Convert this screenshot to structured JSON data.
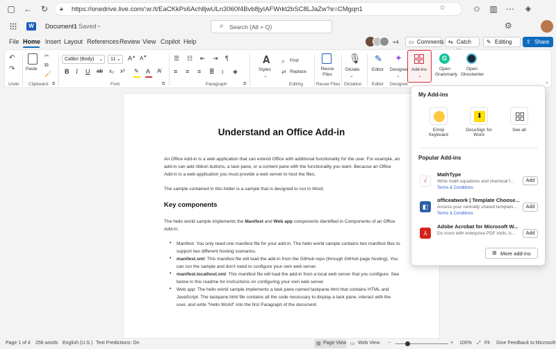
{
  "browser": {
    "url": "https://onedrive.live.com/:w:/t/EaCKkPs6AchlljwULn3060f4Bvb8jyIAFWrkt2bSC8LJaZw?e=CMgqn1"
  },
  "app": {
    "doc_title": "Document1",
    "doc_status": "Saved",
    "search_placeholder": "Search (Alt + Q)",
    "plus_count": "+4"
  },
  "menu": {
    "items": [
      "File",
      "Home",
      "Insert",
      "Layout",
      "References",
      "Review",
      "View",
      "Copilot",
      "Help"
    ],
    "comments": "Comments",
    "catch_up": "Catch Up",
    "editing": "Editing",
    "share": "Share"
  },
  "ribbon": {
    "undo": "Undo",
    "paste": "Paste",
    "clipboard": "Clipboard",
    "font_name": "Calibri (Body)",
    "font_size": "11",
    "font": "Font",
    "paragraph": "Paragraph",
    "styles": "Styles",
    "find": "Find",
    "replace": "Replace",
    "editing": "Editing",
    "reuse_files": "Reuse Files",
    "dictate": "Dictate",
    "dictation": "Dictation",
    "editor": "Editor",
    "designer": "Designer",
    "add_ins": "Add-ins",
    "open_grammarly": "Open Grammarly",
    "open_ghostwriter": "Open Ghostwriter"
  },
  "document": {
    "title": "Understand an Office Add-in",
    "p1": "An Office Add-in is a web application that can extend Office with additional functionality for the user. For example, an add-in can add ribbon buttons, a task pane, or a content pane with the functionality you want. Because an Office Add-in is a web application you must provide a web server to host the files.",
    "p2": "The sample contained in this folder is a sample that is designed to run in Word.",
    "h2": "Key components",
    "p3a": "The hello world sample implements the ",
    "p3b": "Manifest",
    "p3c": " and ",
    "p3d": "Web app",
    "p3e": " components identified in Components of an Office Add-in.",
    "b1": "Manifest: You only need one manifest file for your add-in. The hello world sample contains two manifest files to support two different hosting scenarios.",
    "b2a": "manifest.xml",
    "b2b": ": This manifest file will load the add-in from the GitHub repo (through GitHub page hosting). You can run the sample and don't need to configure your own web server.",
    "b3a": "manifest.localhost.xml",
    "b3b": ": This manifest file will load the add-in from a local web server that you configure. See below in this readme for instructions on configuring your own web server.",
    "b4": "Web app: The hello world sample implements a task pane named taskpane.html that contains HTML and JavaScript. The taskpane.html file contains all the code necessary to display a task pane, interact with the user, and write \"Hello World\" into the first Paragraph of the document."
  },
  "addins_panel": {
    "my_title": "My Add-ins",
    "my_items": [
      {
        "label1": "Emoji",
        "label2": "Keyboard"
      },
      {
        "label1": "DocuSign for",
        "label2": "Word"
      },
      {
        "label1": "See all",
        "label2": ""
      }
    ],
    "popular_title": "Popular Add-ins",
    "popular": [
      {
        "name": "MathType",
        "desc": "Write math equations and chemical f...",
        "terms": "Terms & Conditions",
        "btn": "Add"
      },
      {
        "name": "officeatwork | Template Choose...",
        "desc": "Access your centrally shared templats...",
        "terms": "Terms & Conditions",
        "btn": "Add"
      },
      {
        "name": "Adobe Acrobat for Microsoft W...",
        "desc": "Do more with enterprise PDF tools, b...",
        "terms": "",
        "btn": "Add"
      }
    ],
    "more_btn": "More add-ins"
  },
  "status": {
    "page": "Page 1 of 4",
    "words": "256 words",
    "lang": "English (U.S.)",
    "predictions": "Text Predictions: On",
    "page_view": "Page View",
    "web_view": "Web View",
    "zoom": "100%",
    "fit": "Fit",
    "feedback": "Give Feedback to Microsoft"
  },
  "colors": {
    "accent": "#0f6cbd",
    "word_blue": "#185abd",
    "addins_highlight": "#d13438"
  }
}
